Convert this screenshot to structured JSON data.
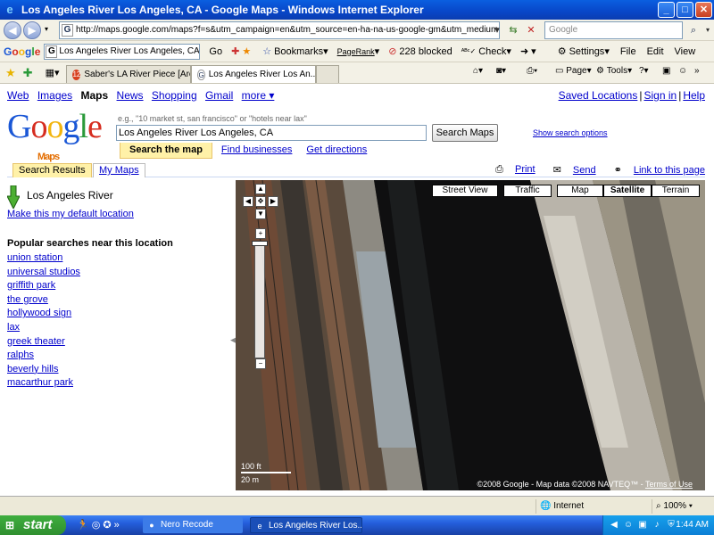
{
  "window": {
    "title": "Los Angeles River Los Angeles, CA - Google Maps - Windows Internet Explorer"
  },
  "address_bar": {
    "url": "http://maps.google.com/maps?f=s&utm_campaign=en&utm_source=en-ha-na-us-google-gm&utm_medium=ha&utm_term=",
    "search_placeholder": "Google"
  },
  "google_toolbar": {
    "logo": "Google",
    "search_value": "Los Angeles River Los Angeles, CA",
    "go_label": "Go",
    "bookmarks_label": "Bookmarks",
    "pagerank_label": "PageRank",
    "blocked_label": "228 blocked",
    "check_label": "Check",
    "settings_label": "Settings",
    "file_label": "File",
    "edit_label": "Edit",
    "view_label": "View"
  },
  "tabs": [
    {
      "label": "Saber's LA River Piece [Archi...",
      "favicon": "12"
    },
    {
      "label": "Los Angeles River Los An...",
      "favicon": "G"
    }
  ],
  "ie_tools": {
    "page_label": "Page",
    "tools_label": "Tools"
  },
  "maps_page": {
    "top_nav": [
      "Web",
      "Images",
      "Maps",
      "News",
      "Shopping",
      "Gmail",
      "more ▾"
    ],
    "right_nav": [
      "Saved Locations",
      "Sign in",
      "Help"
    ],
    "logo_text": "Google",
    "logo_sub": "Maps",
    "search_hint": "e.g., \"10 market st, san francisco\" or \"hotels near lax\"",
    "search_value": "Los Angeles River Los Angeles, CA",
    "search_button": "Search Maps",
    "show_options": "Show search options",
    "sub_tabs": {
      "active": "Search the map",
      "find_businesses": "Find businesses",
      "get_directions": "Get directions"
    },
    "panel_tabs": [
      "Search Results",
      "My Maps"
    ],
    "actions": [
      "Print",
      "Send",
      "Link to this page"
    ],
    "location_title": "Los Angeles River",
    "default_location_link": "Make this my default location",
    "popular_title": "Popular searches near this location",
    "popular_searches": [
      "union station",
      "universal studios",
      "griffith park",
      "the grove",
      "hollywood sign",
      "lax",
      "greek theater",
      "ralphs",
      "beverly hills",
      "macarthur park"
    ],
    "map": {
      "street_view": "Street View",
      "traffic": "Traffic",
      "map_types": [
        "Map",
        "Satellite",
        "Terrain"
      ],
      "selected_type": "Satellite",
      "scale_ft": "100 ft",
      "scale_m": "20 m",
      "copyright": "©2008 Google - Map data ©2008 NAVTEQ™ -",
      "terms": "Terms of Use"
    }
  },
  "status_bar": {
    "zone": "Internet",
    "zoom": "100%"
  },
  "taskbar": {
    "start": "start",
    "tasks": [
      "Nero Recode",
      "Los Angeles River Los..."
    ],
    "clock": "1:44 AM"
  }
}
